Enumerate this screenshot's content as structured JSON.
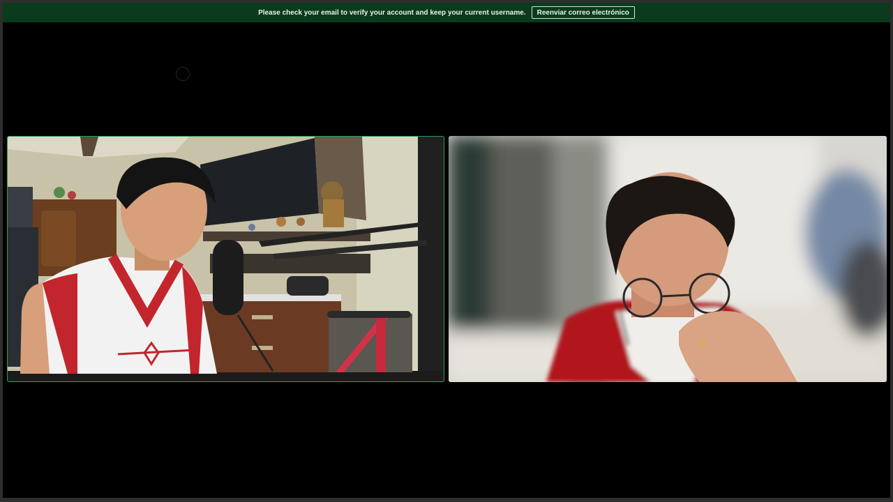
{
  "banner": {
    "message": "Please check your email to verify your account and keep your current username.",
    "button_label": "Reenviar correo electrónico"
  },
  "colors": {
    "banner_bg": "#0a3b1c",
    "stage_bg": "#000000",
    "active_speaker_border": "#2aa05a"
  },
  "participants": [
    {
      "video": "left-participant-video",
      "speaking": true
    },
    {
      "video": "right-participant-video",
      "speaking": false
    }
  ]
}
